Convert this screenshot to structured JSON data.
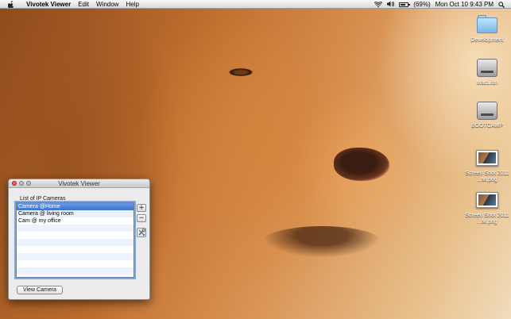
{
  "menubar": {
    "app_name": "Vivotek Viewer",
    "menus": [
      "Edit",
      "Window",
      "Help"
    ],
    "battery": "(69%)",
    "datetime": "Mon Oct 10  9:43 PM"
  },
  "desktop": {
    "icons": [
      {
        "label": "Development",
        "kind": "folder-icon"
      },
      {
        "label": "MacLion",
        "kind": "hard-disk-icon"
      },
      {
        "label": "BOOTCAMP",
        "kind": "hard-disk-icon"
      },
      {
        "label": "Screen Shot 2011 ...M.png",
        "kind": "screenshot-file-icon"
      },
      {
        "label": "Screen Shot 2011 ...M.png",
        "kind": "screenshot-file-icon"
      }
    ]
  },
  "window": {
    "title": "Vivotek Viewer",
    "list_heading": "List of IP Cameras",
    "cameras": [
      "Camera @Home",
      "Camera @ living room",
      "Cam @ my office",
      "",
      "",
      "",
      "",
      "",
      "",
      ""
    ],
    "selected_index": 0,
    "add_label": "+",
    "remove_label": "−",
    "view_button_label": "View Camera"
  },
  "colors": {
    "selection": "#3d72d0",
    "alt_row": "#edf3fe",
    "close_button": "#d6352b"
  }
}
